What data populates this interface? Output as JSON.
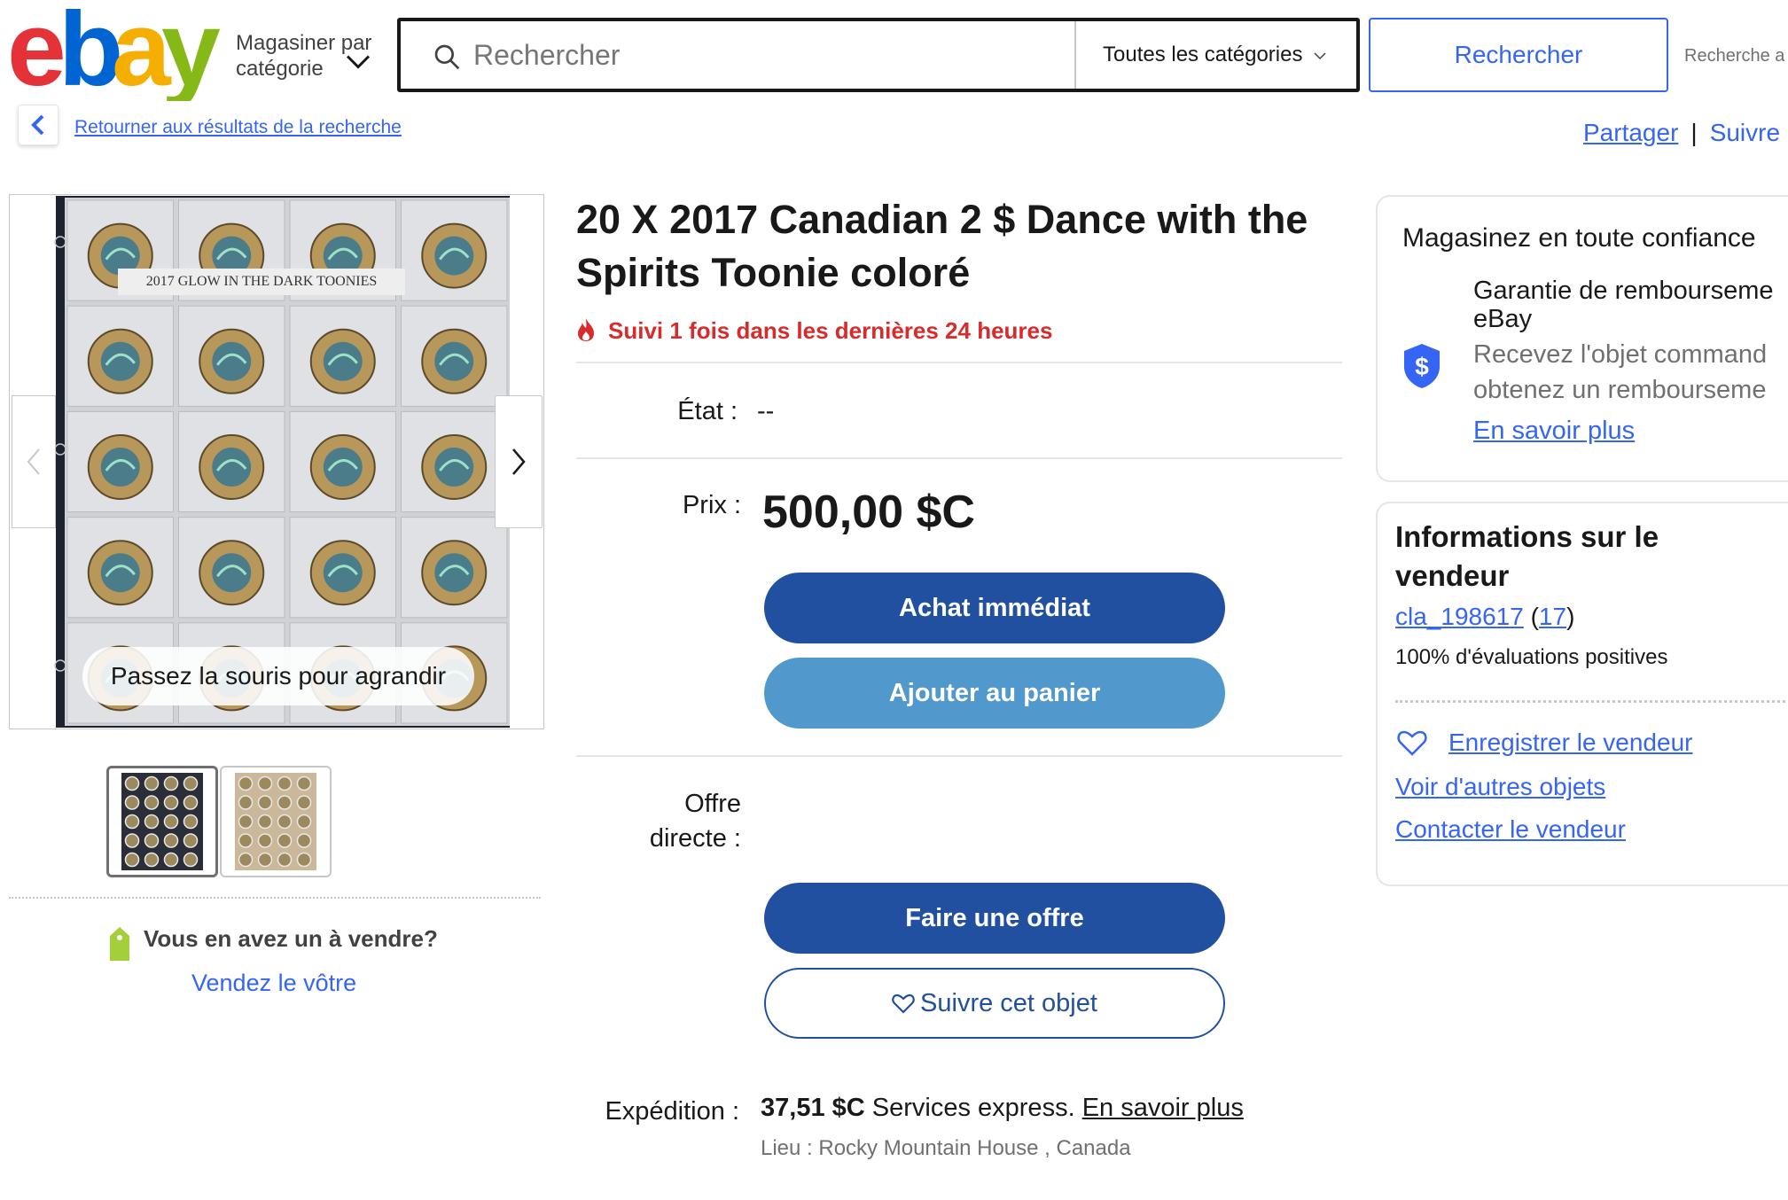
{
  "header": {
    "logo": [
      "e",
      "b",
      "a",
      "y"
    ],
    "logo_colors": [
      "#e53238",
      "#0064d2",
      "#f5af02",
      "#86b817"
    ],
    "shop_by_line1": "Magasiner par",
    "shop_by_line2": "catégorie",
    "search_placeholder": "Rechercher",
    "category_select": "Toutes les catégories",
    "search_button": "Rechercher",
    "advanced_search": "Recherche a"
  },
  "breadcrumb": {
    "back_link": "Retourner aux résultats de la recherche",
    "share": "Partager",
    "separator": "|",
    "follow": "Suivre"
  },
  "gallery": {
    "image_label": "2017 GLOW IN THE DARK TOONIES",
    "zoom_hint": "Passez la souris pour agrandir",
    "thumbnail_count": 2,
    "active_thumbnail": 0
  },
  "sell": {
    "title": "Vous en avez un à vendre?",
    "link": "Vendez le vôtre"
  },
  "listing": {
    "title": "20 X 2017 Canadian 2 $ Dance with the Spirits Toonie coloré",
    "watch_note": "Suivi 1 fois dans les dernières 24 heures",
    "condition_label": "État :",
    "condition_value": "--",
    "price_label": "Prix :",
    "price": "500,00 $C",
    "buy_now": "Achat immédiat",
    "add_to_cart": "Ajouter au panier",
    "best_offer_label_line1": "Offre",
    "best_offer_label_line2": "directe :",
    "make_offer": "Faire une offre",
    "watch_item": "Suivre cet objet",
    "shipping_label": "Expédition :",
    "shipping_price": "37,51 $C",
    "shipping_service": "Services express.",
    "shipping_learn_more": "En savoir plus",
    "location": "Lieu : Rocky Mountain House , Canada"
  },
  "confidence": {
    "title": "Magasinez en toute confiance",
    "guarantee_line1": "Garantie de rembourseme",
    "guarantee_line2": "eBay",
    "desc_line1": "Recevez l'objet command",
    "desc_line2": "obtenez un rembourseme",
    "learn_more": "En savoir plus"
  },
  "seller": {
    "heading": "Informations sur le vendeur",
    "name": "cla_198617",
    "feedback_count": "17",
    "positive": "100% d'évaluations positives",
    "save_seller": "Enregistrer le vendeur",
    "other_items": "Voir d'autres objets",
    "contact": "Contacter le vendeur"
  },
  "colors": {
    "primary": "#2150a0",
    "secondary": "#5199cc",
    "link": "#3665f3",
    "alert": "#d82c2c"
  }
}
